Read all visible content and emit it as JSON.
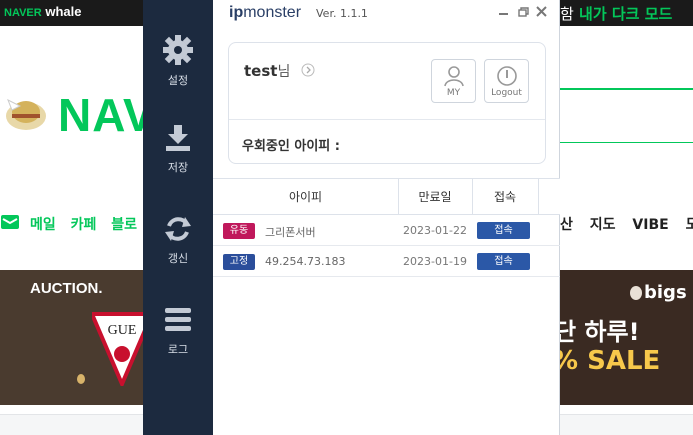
{
  "background": {
    "whale_logo_naver": "NAVER",
    "whale_logo_whale": "whale",
    "dark_mode_prefix": "함",
    "dark_mode_text": "내가 다크 모드",
    "naver_logo": "NAV",
    "nav_left": [
      "메일",
      "카페",
      "블로"
    ],
    "nav_right": [
      "산",
      "지도",
      "VIBE",
      "도서"
    ],
    "auction_label": "AUCTION.",
    "guess_label": "GUE",
    "bigs_label": "bigs",
    "banner_text_1": "단 하루!",
    "banner_text_2": "% SALE"
  },
  "sidebar": {
    "items": [
      {
        "label": "설정",
        "icon": "gear-icon"
      },
      {
        "label": "저장",
        "icon": "download-icon"
      },
      {
        "label": "갱신",
        "icon": "refresh-icon"
      },
      {
        "label": "로그",
        "icon": "menu-icon"
      }
    ]
  },
  "app": {
    "brand_ip": "ip",
    "brand_monster": "monster",
    "version": "Ver. 1.1.1",
    "user": {
      "name": "test",
      "honorific": "님"
    },
    "buttons": {
      "my_label": "MY",
      "logout_label": "Logout"
    },
    "bypass_label": "우회중인 아이피 :",
    "table": {
      "headers": [
        "아이피",
        "만료일",
        "접속"
      ],
      "rows": [
        {
          "type": "유동",
          "type_color": "#c0185b",
          "ip": "그리폰서버",
          "expiry": "2023-01-22",
          "action": "접속"
        },
        {
          "type": "고정",
          "type_color": "#2b4e9b",
          "ip": "49.254.73.183",
          "expiry": "2023-01-19",
          "action": "접속"
        }
      ]
    }
  },
  "colors": {
    "sidebar_bg": "#1c2a3f",
    "accent_green": "#03c75a",
    "connect_blue": "#2b58a7"
  }
}
